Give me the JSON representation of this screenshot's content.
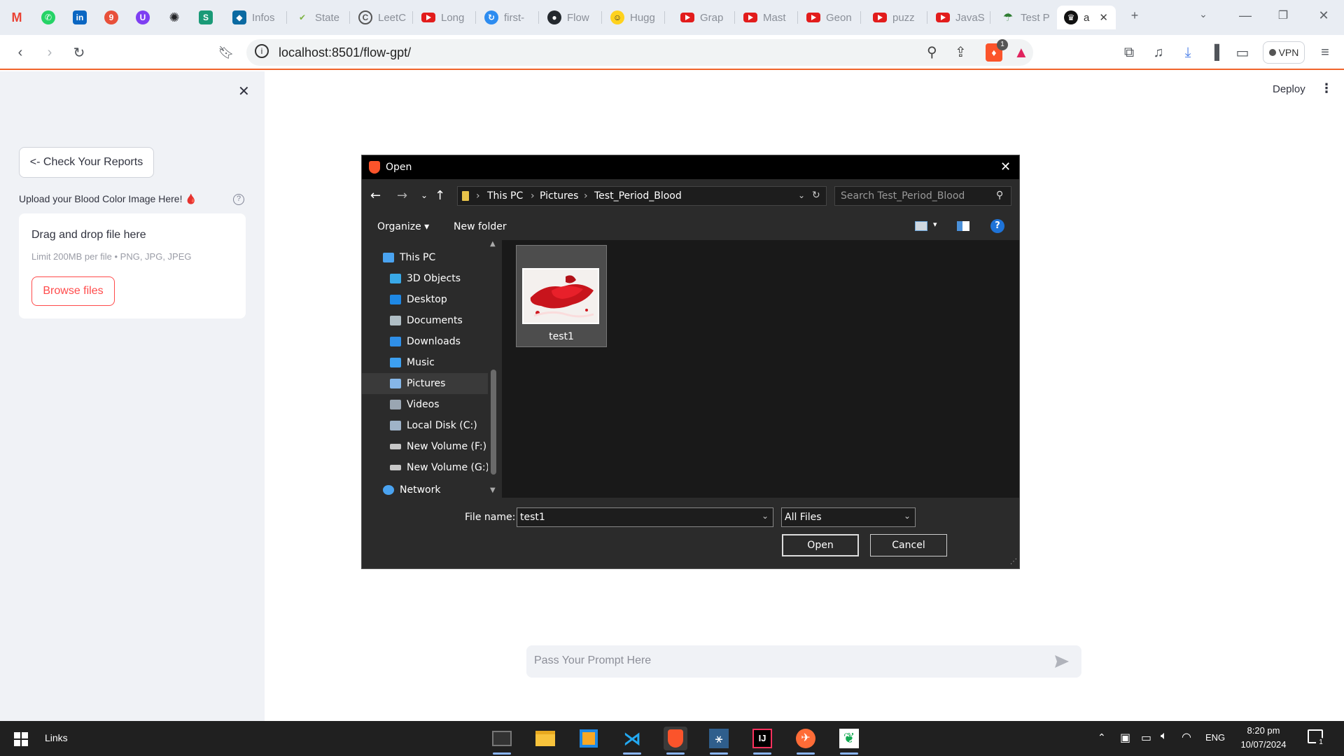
{
  "browser": {
    "tabs": [
      {
        "label": "Infos",
        "icon": "infosys-icon"
      },
      {
        "label": "State",
        "icon": "state-icon"
      },
      {
        "label": "LeetC",
        "icon": "leetcode-icon"
      },
      {
        "label": "Long",
        "icon": "youtube-icon"
      },
      {
        "label": "first-",
        "icon": "first-icon"
      },
      {
        "label": "Flow",
        "icon": "github-icon"
      },
      {
        "label": "Hugg",
        "icon": "huggingface-icon"
      },
      {
        "label": "Grap",
        "icon": "youtube-icon"
      },
      {
        "label": "Mast",
        "icon": "youtube-icon"
      },
      {
        "label": "Geon",
        "icon": "youtube-icon"
      },
      {
        "label": "puzz",
        "icon": "youtube-icon"
      },
      {
        "label": "JavaS",
        "icon": "youtube-icon"
      },
      {
        "label": "Test P",
        "icon": "umbrella-icon"
      },
      {
        "label": "a",
        "icon": "app-icon"
      }
    ],
    "pinned": [
      {
        "letter": "M",
        "color": "#ea4335"
      },
      {
        "letter": "W",
        "color": "#25d366"
      },
      {
        "letter": "in",
        "color": "#0a66c2"
      },
      {
        "letter": "9",
        "color": "#e8503a"
      },
      {
        "letter": "U",
        "color": "#7e3ff2"
      },
      {
        "letter": "✺",
        "color": "#202124"
      },
      {
        "letter": "S",
        "color": "#1a9a77"
      }
    ],
    "url": "localhost:8501/flow-gpt/",
    "vpn_label": "VPN",
    "brave_badge": "1"
  },
  "app": {
    "deploy_label": "Deploy",
    "check_reports_label": "<- Check Your Reports",
    "upload_label": "Upload your Blood Color Image Here! 🩸",
    "drag_drop_label": "Drag and drop file here",
    "limit_label": "Limit 200MB per file • PNG, JPG, JPEG",
    "browse_label": "Browse files",
    "prompt_placeholder": "Pass Your Prompt Here"
  },
  "dialog": {
    "title": "Open",
    "breadcrumb": [
      "This PC",
      "Pictures",
      "Test_Period_Blood"
    ],
    "search_placeholder": "Search Test_Period_Blood",
    "organize_label": "Organize ▾",
    "new_folder_label": "New folder",
    "nav_items": [
      {
        "label": "This PC",
        "icon": "pc-icon",
        "color": "#4aa3f0"
      },
      {
        "label": "3D Objects",
        "icon": "3d-objects-icon",
        "color": "#39a9e8"
      },
      {
        "label": "Desktop",
        "icon": "desktop-icon",
        "color": "#1e88e5"
      },
      {
        "label": "Documents",
        "icon": "documents-icon",
        "color": "#b0bec5"
      },
      {
        "label": "Downloads",
        "icon": "downloads-icon",
        "color": "#2f8fe8"
      },
      {
        "label": "Music",
        "icon": "music-icon",
        "color": "#3da0f0"
      },
      {
        "label": "Pictures",
        "icon": "pictures-icon",
        "color": "#86b7e8"
      },
      {
        "label": "Videos",
        "icon": "videos-icon",
        "color": "#9aa6b2"
      },
      {
        "label": "Local Disk (C:)",
        "icon": "disk-icon",
        "color": "#9fb3c8"
      },
      {
        "label": "New Volume (F:)",
        "icon": "drive-icon",
        "color": "#c8c8c8"
      },
      {
        "label": "New Volume (G:)",
        "icon": "drive-icon",
        "color": "#c8c8c8"
      },
      {
        "label": "Network",
        "icon": "network-icon",
        "color": "#4aa3f0"
      }
    ],
    "files": [
      {
        "name": "test1"
      }
    ],
    "file_name_label": "File name:",
    "file_name_value": "test1",
    "file_type_value": "All Files",
    "open_label": "Open",
    "cancel_label": "Cancel"
  },
  "taskbar": {
    "search_label": "Links",
    "language": "ENG",
    "time": "8:20 pm",
    "date": "10/07/2024",
    "notification_count": "1"
  }
}
